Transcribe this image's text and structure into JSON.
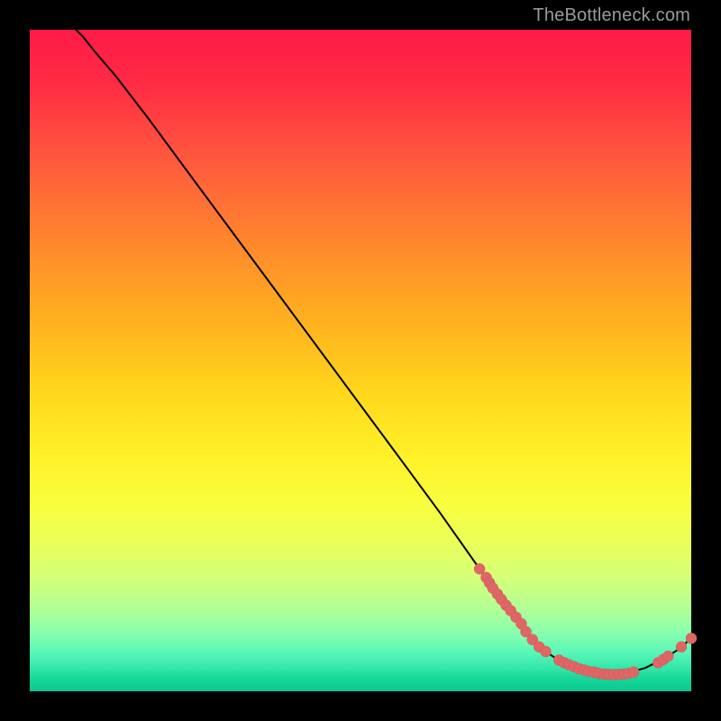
{
  "watermark": "TheBottleneck.com",
  "colors": {
    "curve_stroke": "#000000",
    "marker_fill": "#e06666",
    "marker_stroke": "#c75a5a"
  },
  "chart_data": {
    "type": "line",
    "title": "",
    "xlabel": "",
    "ylabel": "",
    "xlim": [
      0,
      100
    ],
    "ylim": [
      0,
      100
    ],
    "curve": [
      {
        "x": 7,
        "y": 100
      },
      {
        "x": 8,
        "y": 99
      },
      {
        "x": 10,
        "y": 96.5
      },
      {
        "x": 13,
        "y": 93
      },
      {
        "x": 18,
        "y": 86.5
      },
      {
        "x": 25,
        "y": 77
      },
      {
        "x": 35,
        "y": 63.5
      },
      {
        "x": 45,
        "y": 50
      },
      {
        "x": 55,
        "y": 36.5
      },
      {
        "x": 62,
        "y": 27
      },
      {
        "x": 68,
        "y": 18.5
      },
      {
        "x": 72,
        "y": 13
      },
      {
        "x": 75,
        "y": 9
      },
      {
        "x": 78,
        "y": 6
      },
      {
        "x": 81,
        "y": 4
      },
      {
        "x": 84,
        "y": 3
      },
      {
        "x": 87,
        "y": 2.5
      },
      {
        "x": 90,
        "y": 2.7
      },
      {
        "x": 93,
        "y": 3.5
      },
      {
        "x": 96,
        "y": 5
      },
      {
        "x": 98,
        "y": 6.3
      },
      {
        "x": 100,
        "y": 8
      }
    ],
    "markers": [
      {
        "x": 68,
        "y": 18.5
      },
      {
        "x": 69,
        "y": 17.2
      },
      {
        "x": 69.5,
        "y": 16.4
      },
      {
        "x": 70,
        "y": 15.6
      },
      {
        "x": 70.7,
        "y": 14.7
      },
      {
        "x": 71.3,
        "y": 13.9
      },
      {
        "x": 72,
        "y": 13
      },
      {
        "x": 72.7,
        "y": 12.2
      },
      {
        "x": 73.5,
        "y": 11.2
      },
      {
        "x": 74.3,
        "y": 10.2
      },
      {
        "x": 75,
        "y": 9
      },
      {
        "x": 76,
        "y": 7.8
      },
      {
        "x": 77,
        "y": 6.7
      },
      {
        "x": 78,
        "y": 6
      },
      {
        "x": 80,
        "y": 4.7
      },
      {
        "x": 80.8,
        "y": 4.3
      },
      {
        "x": 81.5,
        "y": 4.0
      },
      {
        "x": 82.3,
        "y": 3.7
      },
      {
        "x": 83,
        "y": 3.4
      },
      {
        "x": 83.8,
        "y": 3.2
      },
      {
        "x": 84.5,
        "y": 3.0
      },
      {
        "x": 85.3,
        "y": 2.9
      },
      {
        "x": 86,
        "y": 2.7
      },
      {
        "x": 86.8,
        "y": 2.6
      },
      {
        "x": 87.5,
        "y": 2.55
      },
      {
        "x": 88.3,
        "y": 2.5
      },
      {
        "x": 89,
        "y": 2.55
      },
      {
        "x": 89.8,
        "y": 2.6
      },
      {
        "x": 90.5,
        "y": 2.7
      },
      {
        "x": 91.3,
        "y": 2.9
      },
      {
        "x": 95,
        "y": 4.3
      },
      {
        "x": 95.8,
        "y": 4.8
      },
      {
        "x": 96.5,
        "y": 5.3
      },
      {
        "x": 98.5,
        "y": 6.7
      },
      {
        "x": 100,
        "y": 8
      }
    ]
  }
}
